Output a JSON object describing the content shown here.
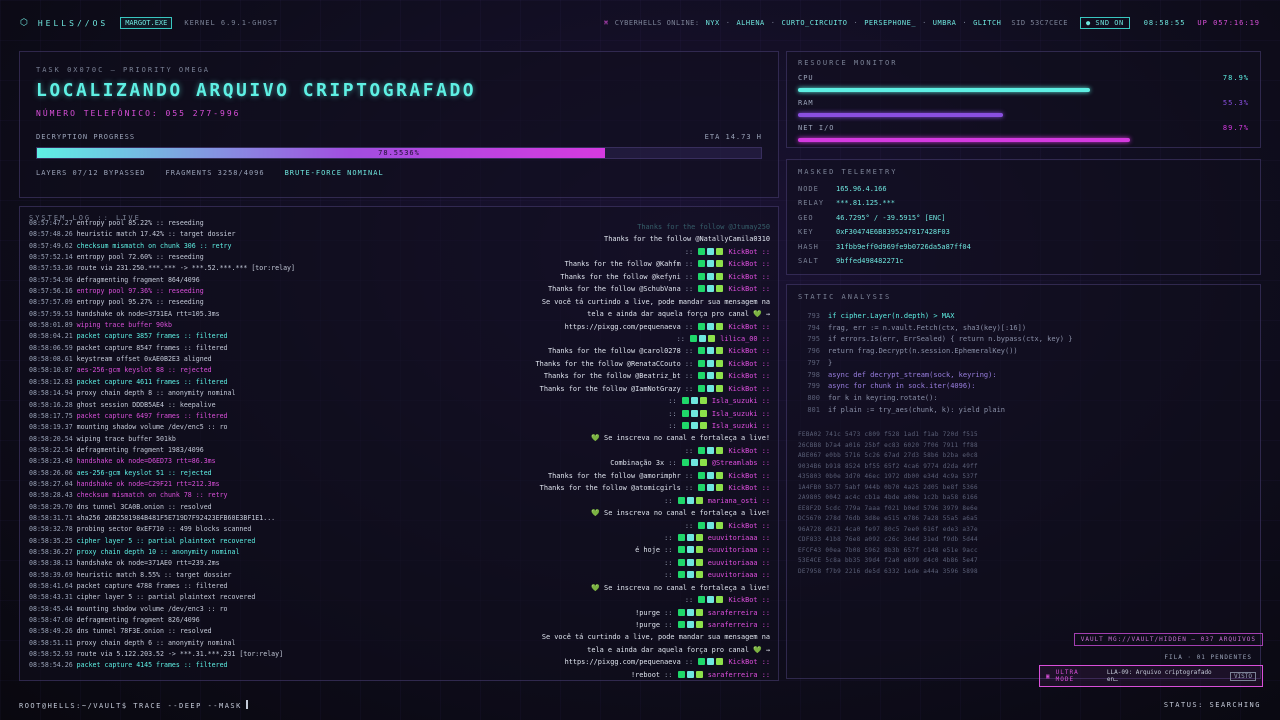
{
  "topbar": {
    "brand": "HELLS//OS",
    "tag": "MARGOT.EXE",
    "kernel": "KERNEL 6.9.1-GHOST",
    "online_label": "CYBERHELLS ONLINE:",
    "users": [
      "NYX",
      "ALHENA",
      "CURTO_CIRCUITO",
      "PERSEPHONE_",
      "UMBRA",
      "GLITCH"
    ],
    "sid": "SID 53C7CECE",
    "snd": "SND ON",
    "clock": "08:58:55",
    "uptime": "UP 057:16:19"
  },
  "task": {
    "label": "TASK 0X070C — PRIORITY OMEGA",
    "title": "LOCALIZANDO ARQUIVO CRIPTOGRAFADO",
    "phone": "NÚMERO TELEFÔNICO: 055 277-996",
    "progress_label": "DECRYPTION PROGRESS",
    "eta": "ETA 14.73 H",
    "progress_pct": 78.5,
    "progress_text": "78.5536%",
    "layers": "LAYERS 07/12 BYPASSED",
    "fragments": "FRAGMENTS 3258/4096",
    "status": "BRUTE-FORCE NOMINAL"
  },
  "resources": {
    "title": "RESOURCE MONITOR",
    "items": [
      {
        "label": "CPU",
        "value": "78.9%",
        "pct": 78.9,
        "color": "#5ef0e4"
      },
      {
        "label": "RAM",
        "value": "55.3%",
        "pct": 55.3,
        "color": "#8a4fe0"
      },
      {
        "label": "NET I/O",
        "value": "89.7%",
        "pct": 89.7,
        "color": "#d53ae0"
      }
    ]
  },
  "telemetry": {
    "title": "MASKED TELEMETRY",
    "rows": [
      {
        "k": "NODE",
        "v": "165.96.4.166"
      },
      {
        "k": "RELAY",
        "v": "***.81.125.***"
      },
      {
        "k": "GEO",
        "v": "46.7295° / -39.5915° [ENC]"
      },
      {
        "k": "KEY",
        "v": "0xF30474E6B8395247817428F03"
      },
      {
        "k": "HASH",
        "v": "31fbb9eff0d969fe9b0726da5a87ff04"
      },
      {
        "k": "SALT",
        "v": "9bffed498482271c"
      }
    ]
  },
  "static": {
    "title": "STATIC ANALYSIS",
    "code": [
      {
        "n": "793",
        "t": "if cipher.Layer(n.depth) > MAX"
      },
      {
        "n": "794",
        "t": "frag, err := n.vault.Fetch(ctx, sha3(key)[:16])"
      },
      {
        "n": "795",
        "t": "if errors.Is(err, ErrSealed) { return n.bypass(ctx, key) }"
      },
      {
        "n": "796",
        "t": "return frag.Decrypt(n.session.EphemeralKey())"
      },
      {
        "n": "797",
        "t": "}"
      },
      {
        "n": "798",
        "t": "async def decrypt_stream(sock, keyring):"
      },
      {
        "n": "799",
        "t": "async for chunk in sock.iter(4096):"
      },
      {
        "n": "800",
        "t": "for k in keyring.rotate():"
      },
      {
        "n": "801",
        "t": "if plain := try_aes(chunk, k): yield plain"
      }
    ],
    "hex": [
      "FEBA02 741c 5473 c809 f528 1ad1 f1ab 720d f515",
      "26CBB8 b7a4 a016 25bf ec83 6020 7f06 7911 ff88",
      "ABE067 e0bb 5716 5c26 67ad 27d3 58b6 b2ba e0c8",
      "9034B6 b918 8524 bf55 65f2 4ca6 9774 d2da 49ff",
      "435803 0b0e 3d70 46ec 1972 db00 e34d 4c9a 537f",
      "1A4FB0 5b77 5abf 944b 0b70 4a25 2d05 be8f 5366",
      "2A9805 0042 ac4c cb1a 4bde a00e 1c2b ba58 6166",
      "EE8F2D 5cdc 779a 7aaa f021 b0ed 5796 3979 8e6e",
      "DC5670 278d 76db 3d8e e515 e786 7a28 55a5 a6a5",
      "96A728 d621 4ca0 fe97 80c5 7ee0 616f ede3 a37e",
      "CDF833 41b8 76e8 a092 c26c 3d4d 31ed f9db 5d44",
      "EFCF43 00ea 7b08 5962 8b3b 657f c148 e51e 9acc",
      "53E4CE 5c8a bb35 39d4 f2a0 e899 d4c0 4b86 5e47",
      "DE7958 f7b9 2216 de5d 6332 1ede a44a 3596 5898"
    ],
    "vault": "VAULT MG://VAULT/HIDDEN — 037 ARQUIVOS",
    "queue": "FILA · 01 PENDENTES",
    "ultra_mode": "ULTRA MODE",
    "ultra_msg": "LLA-09: Arquivo criptografado en…",
    "ultra_btn": "VISTO"
  },
  "log": {
    "title": "SYSTEM LOG :: LIVE",
    "lines": [
      {
        "t": "08:57:47.27",
        "m": "entropy pool 85.22% :: reseeding",
        "c": "c-w"
      },
      {
        "t": "08:57:48.26",
        "m": "heuristic match 17.42% :: target dossier",
        "c": "c-w"
      },
      {
        "t": "08:57:49.62",
        "m": "checksum mismatch on chunk 306 :: retry",
        "c": "c-t"
      },
      {
        "t": "08:57:52.14",
        "m": "entropy pool 72.60% :: reseeding",
        "c": "c-w"
      },
      {
        "t": "08:57:53.36",
        "m": "route via 231.250.***.*** -> ***.52.***.*** [tor:relay]",
        "c": "c-w"
      },
      {
        "t": "08:57:54.96",
        "m": "defragmenting fragment 864/4096",
        "c": "c-w"
      },
      {
        "t": "08:57:56.16",
        "m": "entropy pool 97.36% :: reseeding",
        "c": "c-m"
      },
      {
        "t": "08:57:57.09",
        "m": "entropy pool 95.27% :: reseeding",
        "c": "c-w"
      },
      {
        "t": "08:57:59.53",
        "m": "handshake ok node=3731EA rtt=105.3ms",
        "c": "c-w"
      },
      {
        "t": "08:58:01.89",
        "m": "wiping trace buffer 90kb",
        "c": "c-m"
      },
      {
        "t": "08:58:04.21",
        "m": "packet capture 3857 frames :: filtered",
        "c": "c-t"
      },
      {
        "t": "08:58:06.59",
        "m": "packet capture 8547 frames :: filtered",
        "c": "c-w"
      },
      {
        "t": "08:58:08.61",
        "m": "keystream offset 0xAE0B2E3 aligned",
        "c": "c-w"
      },
      {
        "t": "08:58:10.87",
        "m": "aes-256-gcm keyslot 88 :: rejected",
        "c": "c-m"
      },
      {
        "t": "08:58:12.83",
        "m": "packet capture 4611 frames :: filtered",
        "c": "c-t"
      },
      {
        "t": "08:58:14.94",
        "m": "proxy chain depth 8 :: anonymity nominal",
        "c": "c-w"
      },
      {
        "t": "08:58:16.28",
        "m": "ghost session DDDB5AE4 :: keepalive",
        "c": "c-w"
      },
      {
        "t": "08:58:17.75",
        "m": "packet capture 6497 frames :: filtered",
        "c": "c-m"
      },
      {
        "t": "08:58:19.37",
        "m": "mounting shadow volume /dev/enc5 :: ro",
        "c": "c-w"
      },
      {
        "t": "08:58:20.54",
        "m": "wiping trace buffer 501kb",
        "c": "c-w"
      },
      {
        "t": "08:58:22.54",
        "m": "defragmenting fragment 1983/4096",
        "c": "c-w"
      },
      {
        "t": "08:58:23.49",
        "m": "handshake ok node=D6ED73 rtt=86.3ms",
        "c": "c-m"
      },
      {
        "t": "08:58:26.06",
        "m": "aes-256-gcm keyslot 51 :: rejected",
        "c": "c-t"
      },
      {
        "t": "08:58:27.04",
        "m": "handshake ok node=C29F21 rtt=212.3ms",
        "c": "c-m"
      },
      {
        "t": "08:58:28.43",
        "m": "checksum mismatch on chunk 78 :: retry",
        "c": "c-m"
      },
      {
        "t": "08:58:29.70",
        "m": "dns tunnel 3CA0B.onion :: resolved",
        "c": "c-w"
      },
      {
        "t": "08:58:31.71",
        "m": "sha256 26B2581984B481F5E719D7F92423EFB60E3BF1E1...",
        "c": "c-w"
      },
      {
        "t": "08:58:32.78",
        "m": "probing sector 0xEF710 :: 499 blocks scanned",
        "c": "c-w"
      },
      {
        "t": "08:58:35.25",
        "m": "cipher layer 5 :: partial plaintext recovered",
        "c": "c-t"
      },
      {
        "t": "08:58:36.27",
        "m": "proxy chain depth 10 :: anonymity nominal",
        "c": "c-t"
      },
      {
        "t": "08:58:38.13",
        "m": "handshake ok node=371AE0 rtt=239.2ms",
        "c": "c-w"
      },
      {
        "t": "08:58:39.69",
        "m": "heuristic match 8.55% :: target dossier",
        "c": "c-w"
      },
      {
        "t": "08:58:41.64",
        "m": "packet capture 4788 frames :: filtered",
        "c": "c-w"
      },
      {
        "t": "08:58:43.31",
        "m": "cipher layer 5 :: partial plaintext recovered",
        "c": "c-w"
      },
      {
        "t": "08:58:45.44",
        "m": "mounting shadow volume /dev/enc3 :: ro",
        "c": "c-w"
      },
      {
        "t": "08:58:47.60",
        "m": "defragmenting fragment 826/4096",
        "c": "c-w"
      },
      {
        "t": "08:58:49.26",
        "m": "dns tunnel 78F3E.onion :: resolved",
        "c": "c-w"
      },
      {
        "t": "08:58:51.11",
        "m": "proxy chain depth 6 :: anonymity nominal",
        "c": "c-w"
      },
      {
        "t": "08:58:52.93",
        "m": "route via 5.122.203.52 -> ***.31.***.231 [tor:relay]",
        "c": "c-w"
      },
      {
        "t": "08:58:54.26",
        "m": "packet capture 4145 frames :: filtered",
        "c": "c-t"
      }
    ]
  },
  "chat": [
    {
      "msg": "Thanks for the follow @Jtumay250",
      "user": "",
      "dim": true
    },
    {
      "msg": "Thanks for the follow @NatallyCamila0310",
      "user": "",
      "dim": false
    },
    {
      "msg": "",
      "user": "KickBot ::"
    },
    {
      "msg": "Thanks for the follow @Kahfm",
      "user": "KickBot ::"
    },
    {
      "msg": "Thanks for the follow @kefyni",
      "user": "KickBot ::"
    },
    {
      "msg": "Thanks for the follow @SchubVana",
      "user": "KickBot ::"
    },
    {
      "msg": "Se você tá curtindo a live, pode mandar sua mensagem na",
      "user": ""
    },
    {
      "msg": "tela e ainda dar aquela força pro canal 💚 →",
      "user": ""
    },
    {
      "msg": "https://pixgg.com/pequenaeva",
      "user": "KickBot ::"
    },
    {
      "msg": "",
      "user": "lilica_00 ::"
    },
    {
      "msg": "Thanks for the follow @carol0278",
      "user": "KickBot ::"
    },
    {
      "msg": "Thanks for the follow @RenataCCouto",
      "user": "KickBot ::"
    },
    {
      "msg": "Thanks for the follow @Beatriz_bt",
      "user": "KickBot ::"
    },
    {
      "msg": "Thanks for the follow @IamNotGrazy",
      "user": "KickBot ::"
    },
    {
      "msg": "",
      "user": "Isla_suzuki ::"
    },
    {
      "msg": "",
      "user": "Isla_suzuki ::"
    },
    {
      "msg": "",
      "user": "Isla_suzuki ::"
    },
    {
      "msg": "💚 Se inscreva no canal e fortaleça a live!",
      "user": ""
    },
    {
      "msg": "",
      "user": "KickBot ::"
    },
    {
      "msg": "Combinação 3x",
      "user": "@Streamlabs ::"
    },
    {
      "msg": "Thanks for the follow @amorimphr",
      "user": "KickBot ::"
    },
    {
      "msg": "Thanks for the follow @atomicgirls",
      "user": "KickBot ::"
    },
    {
      "msg": "",
      "user": "mariana_osti ::"
    },
    {
      "msg": "💚 Se inscreva no canal e fortaleça a live!",
      "user": ""
    },
    {
      "msg": "",
      "user": "KickBot ::"
    },
    {
      "msg": "",
      "user": "euuvitoriaaa ::"
    },
    {
      "msg": "é hoje",
      "user": "euuvitoriaaa ::"
    },
    {
      "msg": "",
      "user": "euuvitoriaaa ::"
    },
    {
      "msg": "",
      "user": "euuvitoriaaa ::"
    },
    {
      "msg": "💚 Se inscreva no canal e fortaleça a live!",
      "user": ""
    },
    {
      "msg": "",
      "user": "KickBot ::"
    },
    {
      "msg": "!purge",
      "user": "saraferreira ::"
    },
    {
      "msg": "!purge",
      "user": "saraferreira ::"
    },
    {
      "msg": "Se você tá curtindo a live, pode mandar sua mensagem na",
      "user": ""
    },
    {
      "msg": "tela e ainda dar aquela força pro canal 💚 →",
      "user": ""
    },
    {
      "msg": "https://pixgg.com/pequenaeva",
      "user": "KickBot ::"
    },
    {
      "msg": "!reboot",
      "user": "saraferreira ::"
    }
  ],
  "bottom": {
    "prompt": "ROOT@HELLS:~/VAULT$ TRACE --DEEP --MASK",
    "status": "STATUS: SEARCHING"
  }
}
